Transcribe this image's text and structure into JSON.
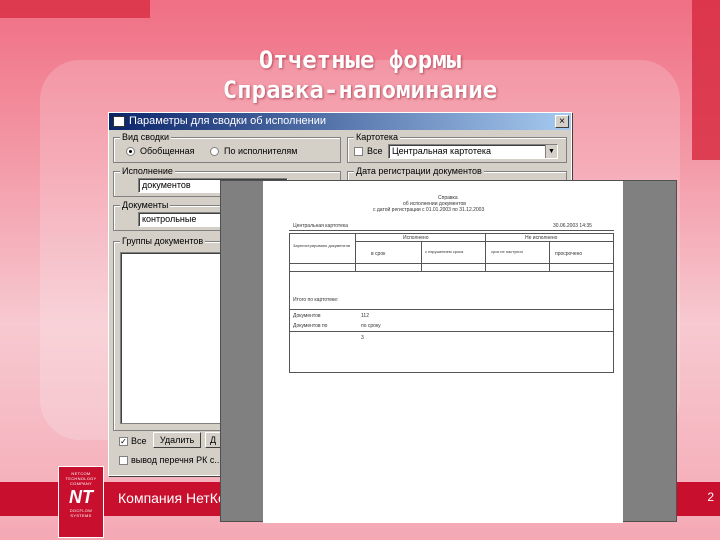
{
  "slide": {
    "title_line1": "Отчетные формы",
    "title_line2": "Справка-напоминание",
    "footer_text": "Компания НетКо",
    "page_number": "2",
    "colors": {
      "brand_red": "#c8102e",
      "title_bar": "#0a246a"
    }
  },
  "logo": {
    "line1": "NETCOM",
    "line2": "TECHNOLOGY",
    "line3": "COMPANY",
    "mark": "NT",
    "line4": "DOCFLOW",
    "line5": "SYSTEMS"
  },
  "dialog": {
    "title": "Параметры для сводки об исполнении",
    "close_glyph": "×",
    "svodka": {
      "label": "Вид сводки",
      "opt_general": "Обобщенная",
      "opt_by_executor": "По исполнителям"
    },
    "kartoteka": {
      "label": "Картотека",
      "all_checkbox_label": "Все",
      "value": "Центральная картотека"
    },
    "ispolnenie": {
      "label": "Исполнение",
      "value": "документов"
    },
    "period_label": "Дата регистрации документов",
    "dokumenty": {
      "label": "Документы",
      "value": "контрольные"
    },
    "group_label": "Группы документов",
    "bottom": {
      "all_checkbox_label": "Все",
      "delete_button": "Удалить",
      "add_button": "Д",
      "print_checkbox_label": "вывод перечня РК с..."
    }
  },
  "report": {
    "header_line1": "Справка",
    "header_line2": "об исполнении документов",
    "header_line3": "с датой регистрации с 01.01.2003 по 31.12.2003",
    "org": "Центральная картотека",
    "date": "30.06.2003 14:35",
    "col_group1": "Исполнено",
    "col_group2": "Не исполнено",
    "col_total": "Зарегистрировано документов",
    "col_ontime": "в срок",
    "col_late": "с нарушением срока",
    "col_intime": "срок не наступил",
    "col_overdue": "просрочено",
    "row_total": "Итого по картотеке:",
    "row_docs": "Документов",
    "row_docs_val": "112",
    "row_exec": "Документов по",
    "row_exec_val": "по сроку",
    "row_other": "3"
  }
}
